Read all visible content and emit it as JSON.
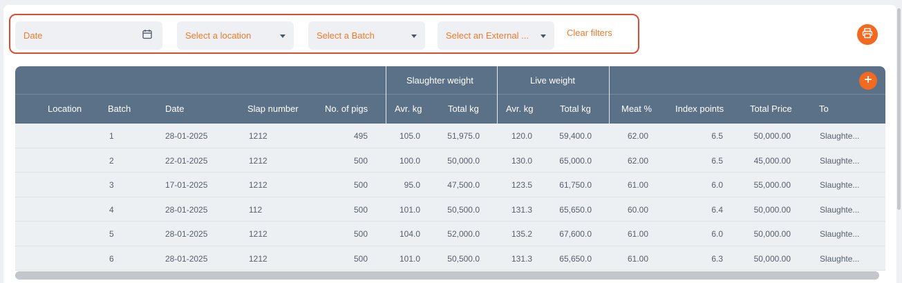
{
  "filters": {
    "date_placeholder": "Date",
    "location_placeholder": "Select a location",
    "batch_placeholder": "Select a Batch",
    "external_placeholder": "Select an External ...",
    "clear_label": "Clear filters"
  },
  "table": {
    "group_headers": {
      "slaughter_weight": "Slaughter weight",
      "live_weight": "Live weight"
    },
    "columns": {
      "location": "Location",
      "batch": "Batch",
      "date": "Date",
      "slap_number": "Slap number",
      "no_pigs": "No. of pigs",
      "sw_avg": "Avr. kg",
      "sw_total": "Total kg",
      "lw_avg": "Avr. kg",
      "lw_total": "Total kg",
      "meat": "Meat %",
      "index": "Index points",
      "price": "Total Price",
      "to": "To"
    },
    "rows": [
      {
        "location": "",
        "batch": "1",
        "date": "28-01-2025",
        "slap": "1212",
        "pigs": "495",
        "sw_avg": "105.0",
        "sw_total": "51,975.0",
        "lw_avg": "120.0",
        "lw_total": "59,400.0",
        "meat": "62.00",
        "index": "6.5",
        "price": "50,000.00",
        "to": "Slaughte..."
      },
      {
        "location": "",
        "batch": "2",
        "date": "22-01-2025",
        "slap": "1212",
        "pigs": "500",
        "sw_avg": "100.0",
        "sw_total": "50,000.0",
        "lw_avg": "130.0",
        "lw_total": "65,000.0",
        "meat": "62.00",
        "index": "6.5",
        "price": "45,000.00",
        "to": "Slaughte..."
      },
      {
        "location": "",
        "batch": "3",
        "date": "17-01-2025",
        "slap": "1212",
        "pigs": "500",
        "sw_avg": "95.0",
        "sw_total": "47,500.0",
        "lw_avg": "123.5",
        "lw_total": "61,750.0",
        "meat": "61.00",
        "index": "6.0",
        "price": "55,000.00",
        "to": "Slaughte..."
      },
      {
        "location": "",
        "batch": "4",
        "date": "28-01-2025",
        "slap": "112",
        "pigs": "500",
        "sw_avg": "101.0",
        "sw_total": "50,500.0",
        "lw_avg": "131.3",
        "lw_total": "65,650.0",
        "meat": "60.00",
        "index": "6.4",
        "price": "50,000.00",
        "to": "Slaughte..."
      },
      {
        "location": "",
        "batch": "5",
        "date": "28-01-2025",
        "slap": "1212",
        "pigs": "500",
        "sw_avg": "104.0",
        "sw_total": "52,000.0",
        "lw_avg": "135.2",
        "lw_total": "67,600.0",
        "meat": "61.00",
        "index": "6.0",
        "price": "50,000.00",
        "to": "Slaughte..."
      },
      {
        "location": "",
        "batch": "6",
        "date": "28-01-2025",
        "slap": "1212",
        "pigs": "500",
        "sw_avg": "101.0",
        "sw_total": "50,500.0",
        "lw_avg": "131.3",
        "lw_total": "65,650.0",
        "meat": "61.00",
        "index": "6.3",
        "price": "50,000.00",
        "to": "Slaughte..."
      }
    ]
  },
  "icons": {
    "date": "calendar-icon",
    "print": "printer-icon",
    "add": "plus-icon",
    "dropdown": "caret-down-icon"
  },
  "colors": {
    "accent": "#f26a21",
    "filter_outline": "#e04a31",
    "header_bg": "#5a7187",
    "row_bg": "#edf0f3"
  }
}
